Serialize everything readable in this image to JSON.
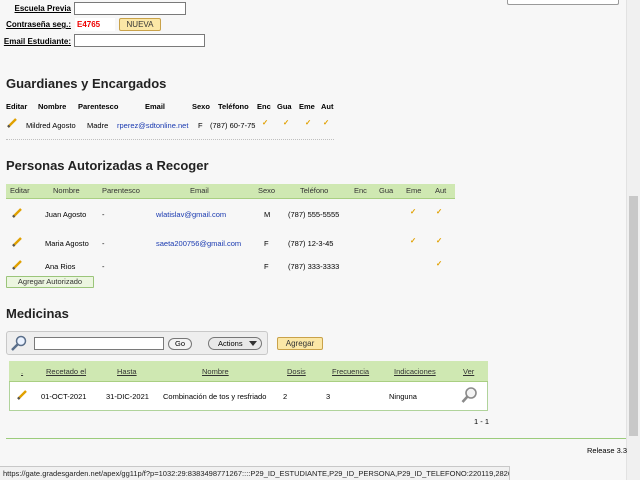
{
  "form": {
    "escuela_label": "Escuela Previa",
    "password_label": "Contraseña seg.:",
    "password_value": "E4765",
    "nueva_button": "NUEVA",
    "email_label": "Email Estudiante:"
  },
  "guardians": {
    "title": "Guardianes y Encargados",
    "headers": {
      "editar": "Editar",
      "nombre": "Nombre",
      "parentesco": "Parentesco",
      "email": "Email",
      "sexo": "Sexo",
      "telefono": "Teléfono",
      "enc": "Enc",
      "gua": "Gua",
      "eme": "Eme",
      "aut": "Aut"
    },
    "rows": [
      {
        "nombre": "Mildred Agosto",
        "parentesco": "Madre",
        "email": "rperez@sdtonline.net",
        "sexo": "F",
        "telefono": "(787) 60-7-75",
        "enc": "✓",
        "gua": "✓",
        "eme": "✓",
        "aut": "✓"
      }
    ]
  },
  "authorized": {
    "title": "Personas Autorizadas a Recoger",
    "headers": {
      "editar": "Editar",
      "nombre": "Nombre",
      "parentesco": "Parentesco",
      "email": "Email",
      "sexo": "Sexo",
      "telefono": "Teléfono",
      "enc": "Enc",
      "gua": "Gua",
      "eme": "Eme",
      "aut": "Aut"
    },
    "rows": [
      {
        "nombre": "Juan Agosto",
        "parentesco": "-",
        "email": "wlatislav@gmail.com",
        "sexo": "M",
        "telefono": "(787) 555-5555",
        "eme": "✓",
        "aut": "✓"
      },
      {
        "nombre": "Maria Agosto",
        "parentesco": "-",
        "email": "saeta200756@gmail.com",
        "sexo": "F",
        "telefono": "(787) 12-3-45",
        "eme": "✓",
        "aut": "✓"
      },
      {
        "nombre": "Ana Rios",
        "parentesco": "-",
        "email": "",
        "sexo": "F",
        "telefono": "(787) 333-3333",
        "eme": "",
        "aut": "✓"
      }
    ],
    "add_button": "Agregar Autorizado"
  },
  "medicines": {
    "title": "Medicinas",
    "go_button": "Go",
    "actions_button": "Actions",
    "add_button": "Agregar",
    "headers": {
      "dot": ".",
      "recetado": "Recetado el",
      "hasta": "Hasta",
      "nombre": "Nombre",
      "dosis": "Dosis",
      "frecuencia": "Frecuencia",
      "indicaciones": "Indicaciones",
      "ver": "Ver"
    },
    "rows": [
      {
        "recetado": "01-OCT-2021",
        "hasta": "31-DIC-2021",
        "nombre": "Combinación de tos y resfriado",
        "dosis": "2",
        "frecuencia": "3",
        "indicaciones": "Ninguna"
      }
    ],
    "pagination": "1 - 1"
  },
  "footer": {
    "release": "Release 3.3"
  },
  "status_bar": {
    "url": "https://gate.gradesgarden.net/apex/gg11p/f?p=1032:29:8383498771267::::P29_ID_ESTUDIANTE,P29_ID_PERSONA,P29_ID_TELEFONO:220119,282664,189963"
  },
  "colors": {
    "grid_header": "#cfe8b2",
    "check": "#e0a000",
    "password": "#ee0000",
    "button_yellow": "#fbe7a6",
    "link": "#1a3ab0"
  }
}
